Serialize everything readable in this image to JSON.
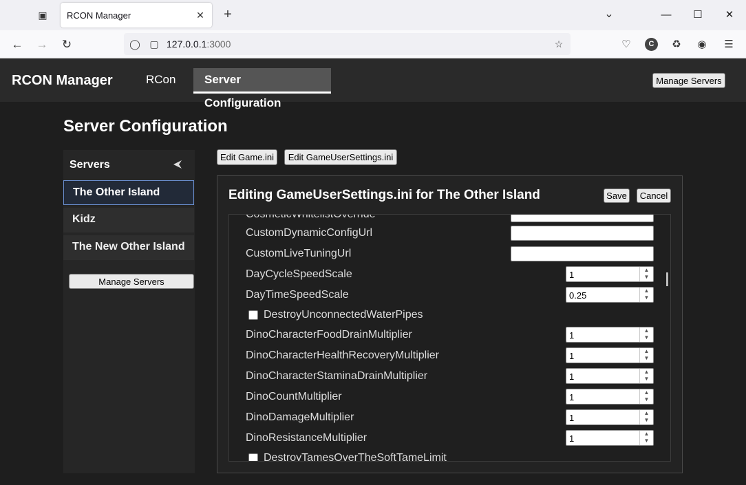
{
  "browser": {
    "tab_title": "RCON Manager",
    "url_host": "127.0.0.1",
    "url_port": ":3000",
    "profile_initial": "C"
  },
  "app": {
    "brand": "RCON Manager",
    "nav": [
      "RCon",
      "Server Configuration"
    ],
    "manage_servers_label": "Manage Servers"
  },
  "page": {
    "title": "Server Configuration",
    "edit_game_ini": "Edit Game.ini",
    "edit_gus_ini": "Edit GameUserSettings.ini"
  },
  "sidebar": {
    "heading": "Servers",
    "servers": [
      "The Other Island",
      "Kidz",
      "The New Other Island"
    ],
    "selected": "The Other Island",
    "manage_servers_label": "Manage Servers"
  },
  "editor": {
    "title": "Editing GameUserSettings.ini for The Other Island",
    "save": "Save",
    "cancel": "Cancel",
    "settings": [
      {
        "label": "CosmeticWhitelistOverride",
        "type": "text",
        "value": ""
      },
      {
        "label": "CustomDynamicConfigUrl",
        "type": "text",
        "value": ""
      },
      {
        "label": "CustomLiveTuningUrl",
        "type": "text",
        "value": ""
      },
      {
        "label": "DayCycleSpeedScale",
        "type": "number",
        "value": "1"
      },
      {
        "label": "DayTimeSpeedScale",
        "type": "number",
        "value": "0.25"
      },
      {
        "label": "DestroyUnconnectedWaterPipes",
        "type": "checkbox",
        "checked": false
      },
      {
        "label": "DinoCharacterFoodDrainMultiplier",
        "type": "number",
        "value": "1"
      },
      {
        "label": "DinoCharacterHealthRecoveryMultiplier",
        "type": "number",
        "value": "1"
      },
      {
        "label": "DinoCharacterStaminaDrainMultiplier",
        "type": "number",
        "value": "1"
      },
      {
        "label": "DinoCountMultiplier",
        "type": "number",
        "value": "1"
      },
      {
        "label": "DinoDamageMultiplier",
        "type": "number",
        "value": "1"
      },
      {
        "label": "DinoResistanceMultiplier",
        "type": "number",
        "value": "1"
      },
      {
        "label": "DestroyTamesOverTheSoftTameLimit",
        "type": "checkbox",
        "checked": false
      }
    ]
  }
}
